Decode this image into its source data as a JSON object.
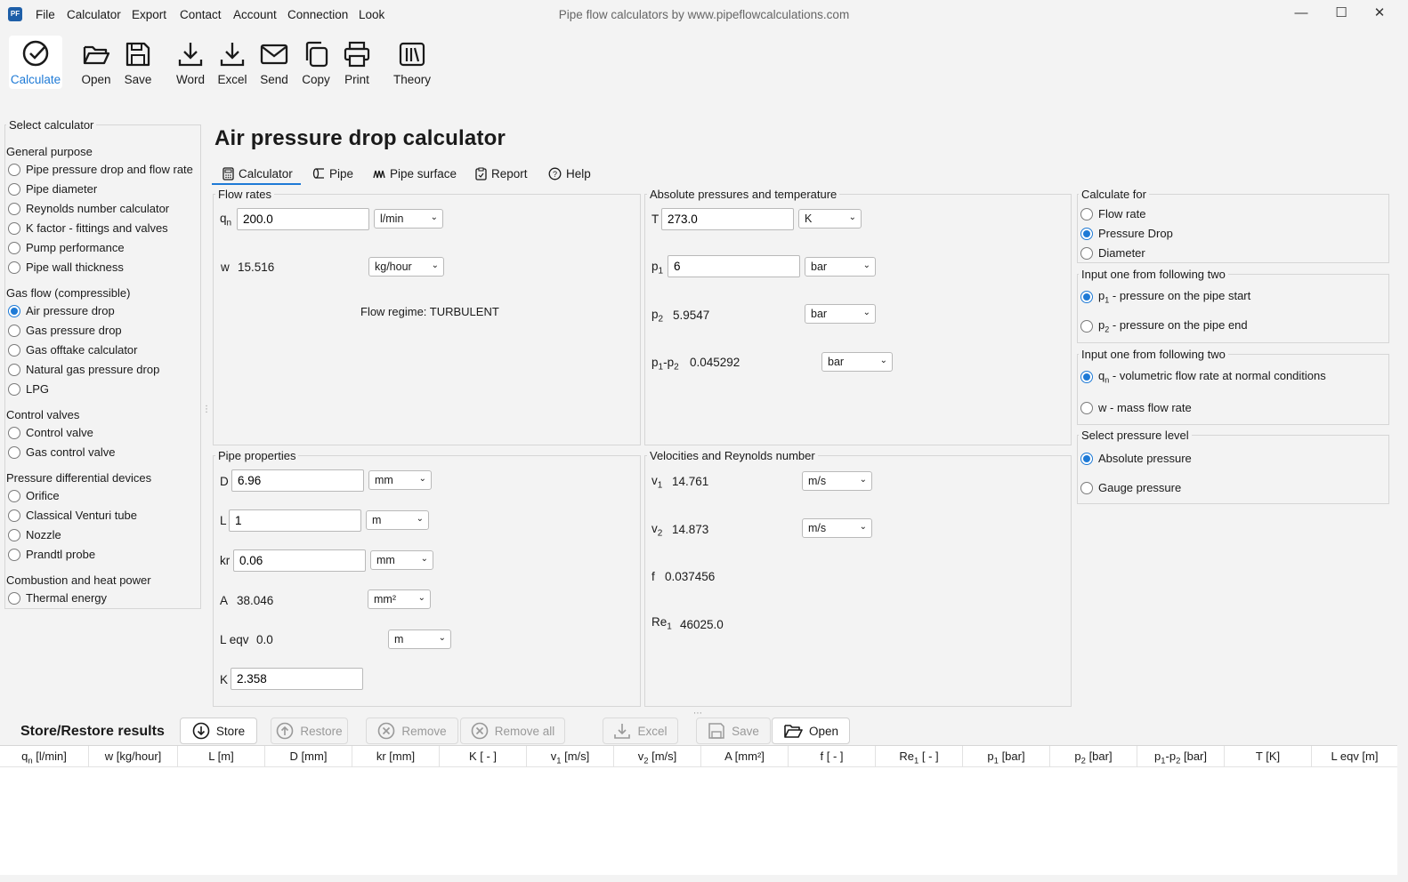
{
  "window": {
    "title": "Pipe flow calculators by www.pipeflowcalculations.com"
  },
  "menu": [
    "File",
    "Calculator",
    "Export",
    "Contact",
    "Account",
    "Connection",
    "Look"
  ],
  "toolbar": {
    "calculate": "Calculate",
    "open": "Open",
    "save": "Save",
    "word": "Word",
    "excel": "Excel",
    "send": "Send",
    "copy": "Copy",
    "print": "Print",
    "theory": "Theory"
  },
  "sidebar": {
    "title": "Select calculator",
    "groups": [
      {
        "label": "General purpose",
        "items": [
          "Pipe pressure drop and flow rate",
          "Pipe diameter",
          "Reynolds number calculator",
          "K factor - fittings and valves",
          "Pump performance",
          "Pipe wall thickness"
        ]
      },
      {
        "label": "Gas flow (compressible)",
        "items": [
          "Air pressure drop",
          "Gas pressure drop",
          "Gas offtake calculator",
          "Natural gas pressure drop",
          "LPG"
        ]
      },
      {
        "label": "Control valves",
        "items": [
          "Control valve",
          "Gas control valve"
        ]
      },
      {
        "label": "Pressure differential devices",
        "items": [
          "Orifice",
          "Classical Venturi tube",
          "Nozzle",
          "Prandtl probe"
        ]
      },
      {
        "label": "Combustion and heat power",
        "items": [
          "Thermal energy"
        ]
      }
    ],
    "selected": "Air pressure drop"
  },
  "page": {
    "title": "Air pressure drop calculator"
  },
  "tabs": [
    "Calculator",
    "Pipe",
    "Pipe surface",
    "Report",
    "Help"
  ],
  "flow_rates": {
    "title": "Flow rates",
    "qn_label": "q",
    "qn_sub": "n",
    "qn_value": "200.0",
    "qn_unit": "l/min",
    "w_label": "w",
    "w_value": "15.516",
    "w_unit": "kg/hour",
    "regime": "Flow regime: TURBULENT"
  },
  "pressures": {
    "title": "Absolute pressures and temperature",
    "T_label": "T",
    "T_value": "273.0",
    "T_unit": "K",
    "p1_value": "6",
    "p1_unit": "bar",
    "p2_value": "5.9547",
    "p2_unit": "bar",
    "dp_value": "0.045292",
    "dp_unit": "bar"
  },
  "pipe": {
    "title": "Pipe properties",
    "D_label": "D",
    "D_value": "6.96",
    "D_unit": "mm",
    "L_label": "L",
    "L_value": "1",
    "L_unit": "m",
    "kr_label": "kr",
    "kr_value": "0.06",
    "kr_unit": "mm",
    "A_label": "A",
    "A_value": "38.046",
    "A_unit": "mm²",
    "Leqv_label": "L eqv",
    "Leqv_value": "0.0",
    "Leqv_unit": "m",
    "K_label": "K",
    "K_value": "2.358"
  },
  "velocities": {
    "title": "Velocities and Reynolds number",
    "v1_value": "14.761",
    "v1_unit": "m/s",
    "v2_value": "14.873",
    "v2_unit": "m/s",
    "f_label": "f",
    "f_value": "0.037456",
    "Re_value": "46025.0"
  },
  "calculate_for": {
    "title": "Calculate for",
    "options": [
      "Flow rate",
      "Pressure Drop",
      "Diameter"
    ],
    "selected": "Pressure Drop"
  },
  "input_pressure": {
    "title": "Input one from following two",
    "opt1": "- pressure on the pipe start",
    "opt2": "- pressure on the pipe end"
  },
  "input_flow": {
    "title": "Input one from following two",
    "opt1": "- volumetric flow rate at normal conditions",
    "opt2": "w - mass flow rate"
  },
  "pressure_level": {
    "title": "Select pressure level",
    "options": [
      "Absolute pressure",
      "Gauge pressure"
    ],
    "selected": "Absolute pressure"
  },
  "store": {
    "title": "Store/Restore results",
    "store": "Store",
    "restore": "Restore",
    "remove": "Remove",
    "remove_all": "Remove all",
    "excel": "Excel",
    "save": "Save",
    "open": "Open"
  },
  "table_headers": [
    "q_n [l/min]",
    "w [kg/hour]",
    "L [m]",
    "D [mm]",
    "kr [mm]",
    "K [ - ]",
    "v_1 [m/s]",
    "v_2 [m/s]",
    "A [mm²]",
    "f [ - ]",
    "Re_1 [ - ]",
    "p_1 [bar]",
    "p_2 [bar]",
    "p_1-p_2 [bar]",
    "T [K]",
    "L eqv [m]"
  ],
  "colors": {
    "accent": "#1e7ad6",
    "background": "#f3f3f3",
    "border": "#d6d6d6"
  }
}
